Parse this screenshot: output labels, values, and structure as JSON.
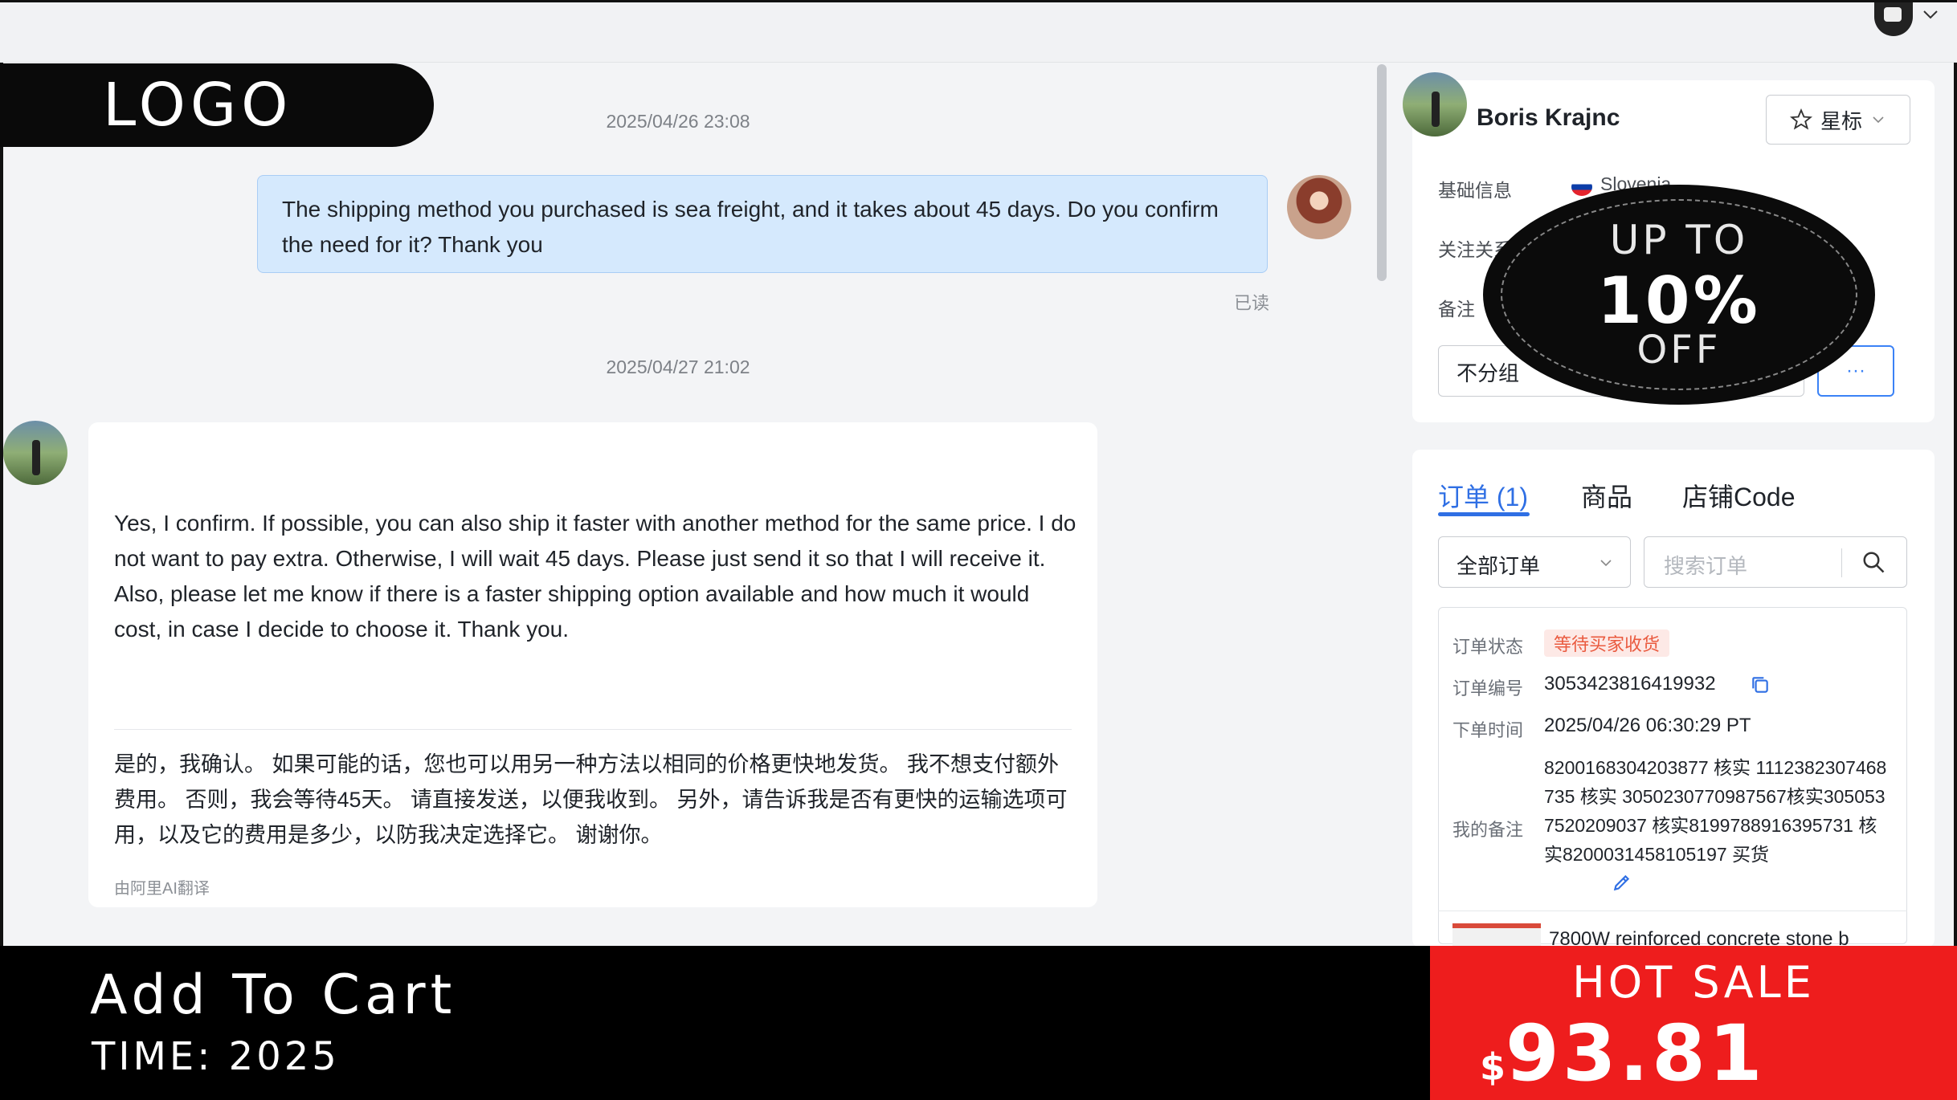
{
  "header": {
    "avatar_label": "",
    "colors": {
      "accent": "#2f6fe4",
      "bubble": "#d5e9fd",
      "badge_text": "#ea5a3f"
    }
  },
  "logo": {
    "text": "LOGO"
  },
  "chat": {
    "messages": [
      {
        "timestamp": "2025/04/26 23:08",
        "direction": "outgoing",
        "text": "The shipping method you purchased is sea freight, and it takes about 45 days. Do you confirm the need for it? Thank you",
        "read_status": "已读"
      },
      {
        "timestamp": "2025/04/27 21:02",
        "direction": "incoming",
        "text": "Yes, I confirm. If possible, you can also ship it faster with another method for the same price. I do not want to pay extra. Otherwise, I will wait 45 days. Please just send it so that I will receive it. Also, please let me know if there is a faster shipping option available and how much it would cost, in case I decide to choose it. Thank you.",
        "translation": "是的，我确认。 如果可能的话，您也可以用另一种方法以相同的价格更快地发货。 我不想支付额外费用。 否则，我会等待45天。 请直接发送，以便我收到。 另外，请告诉我是否有更快的运输选项可用，以及它的费用是多少，以防我决定选择它。 谢谢你。",
        "translated_by": "由阿里AI翻译"
      }
    ]
  },
  "contact": {
    "name": "Boris Krajnc",
    "star_label": "星标",
    "basic_info_label": "基础信息",
    "country": "Slovenia",
    "relation_label": "关注关系",
    "remark_label": "备注",
    "group_value": "不分组",
    "more_label": "···"
  },
  "promo_circle": {
    "line1": "UP TO",
    "line2": "10%",
    "line3": "OFF"
  },
  "orders": {
    "tabs": [
      {
        "label": "订单 (1)"
      },
      {
        "label": "商品"
      },
      {
        "label": "店铺Code"
      }
    ],
    "filter_value": "全部订单",
    "search_placeholder": "搜索订单",
    "order": {
      "status_label": "订单状态",
      "status_value": "等待买家收货",
      "number_label": "订单编号",
      "number_value": "3053423816419932",
      "time_label": "下单时间",
      "time_value": "2025/04/26 06:30:29 PT",
      "note_label": "我的备注",
      "note_value": "8200168304203877 核实 1112382307468735 核实 3050230770987567核实3050537520209037 核实8199788916395731 核实8200031458105197 买货",
      "product_title": "7800W reinforced concrete stone b"
    }
  },
  "banner": {
    "line1": "Add To Cart",
    "line2": "TIME: 2025"
  },
  "hot_sale": {
    "label": "HOT SALE",
    "currency": "$",
    "price": "93.81"
  }
}
